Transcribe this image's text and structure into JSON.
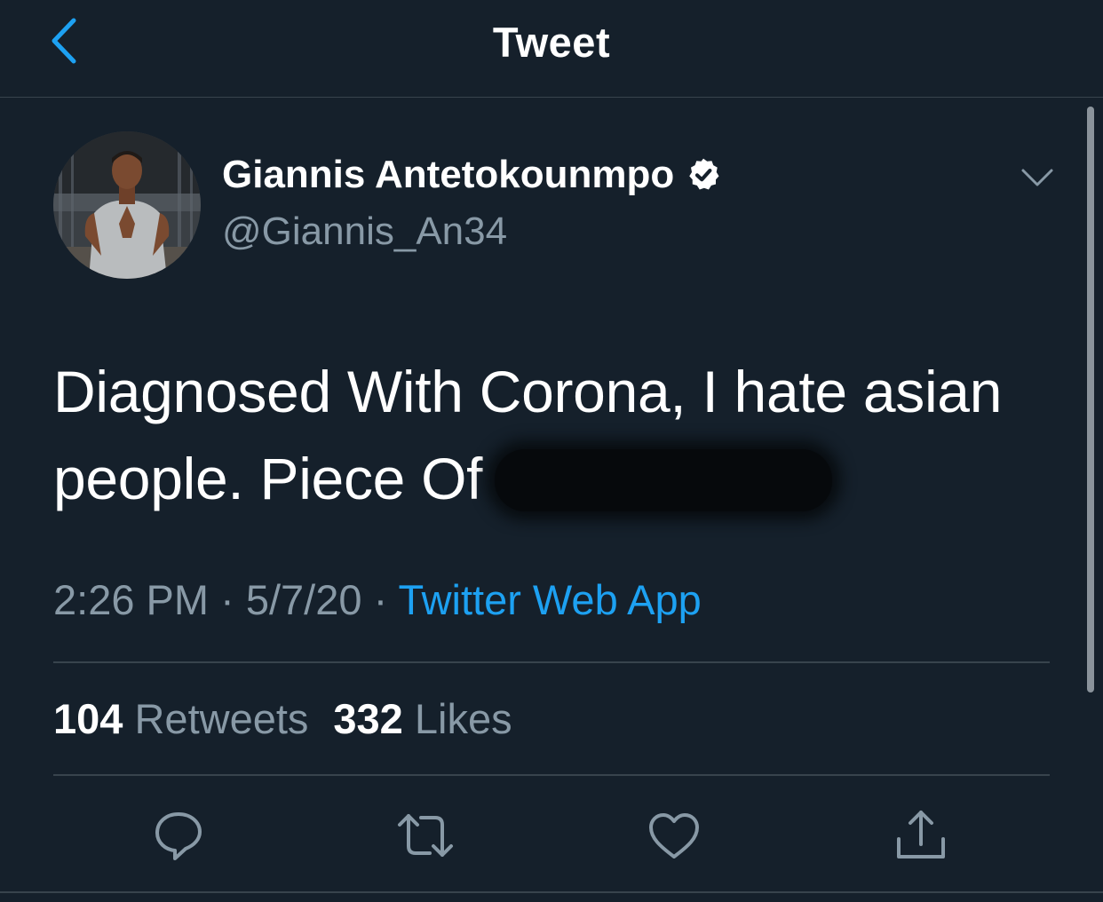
{
  "nav": {
    "title": "Tweet"
  },
  "author": {
    "name": "Giannis Antetokounmpo",
    "handle": "@Giannis_An34",
    "verified": true
  },
  "tweet": {
    "line1": "Diagnosed With Corona, I hate asian",
    "line2": "people. Piece Of",
    "time": "2:26 PM",
    "date": "5/7/20",
    "source": "Twitter Web App"
  },
  "stats": {
    "retweets_count": "104",
    "retweets_label": "Retweets",
    "likes_count": "332",
    "likes_label": "Likes"
  },
  "icons": {
    "back": "chevron-left-icon",
    "verified": "verified-badge-icon",
    "more": "chevron-down-icon",
    "reply": "reply-icon",
    "retweet": "retweet-icon",
    "like": "heart-icon",
    "share": "share-icon"
  },
  "colors": {
    "background": "#15202b",
    "accent": "#1da1f2",
    "secondary_text": "#8899a6",
    "divider": "#38444d"
  }
}
